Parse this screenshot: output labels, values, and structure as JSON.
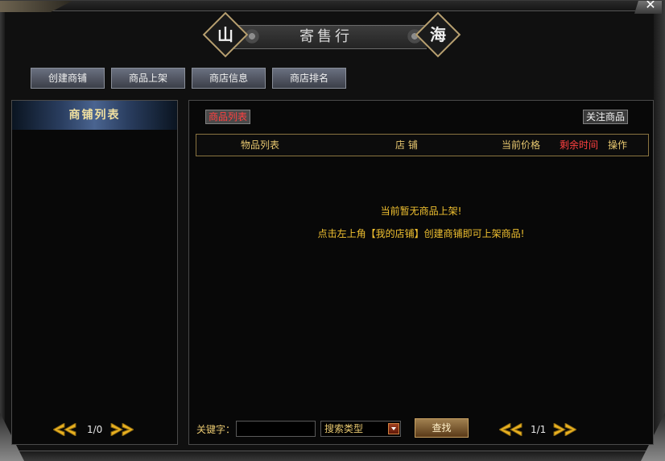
{
  "window": {
    "title": "寄售行",
    "left_badge": "山",
    "right_badge": "海",
    "close_glyph": "✕"
  },
  "toolbar": {
    "buttons": [
      "创建商铺",
      "商品上架",
      "商店信息",
      "商店排名"
    ]
  },
  "left_panel": {
    "header": "商铺列表",
    "pager": "1/0"
  },
  "right_panel": {
    "tab_label": "商品列表",
    "follow_label": "关注商品",
    "columns": {
      "item": "物品列表",
      "shop": "店 铺",
      "price": "当前价格",
      "time_left": "剩余时间",
      "action": "操作"
    },
    "notice_line1": "当前暂无商品上架!",
    "notice_line2": "点击左上角【我的店铺】创建商铺即可上架商品!",
    "keyword_label": "关键字：",
    "keyword_value": "",
    "search_type": "搜索类型",
    "search_button": "查找",
    "pager": "1/1"
  },
  "colors": {
    "gold": "#e8c870",
    "red": "#ff4040",
    "notice": "#f0c030"
  }
}
